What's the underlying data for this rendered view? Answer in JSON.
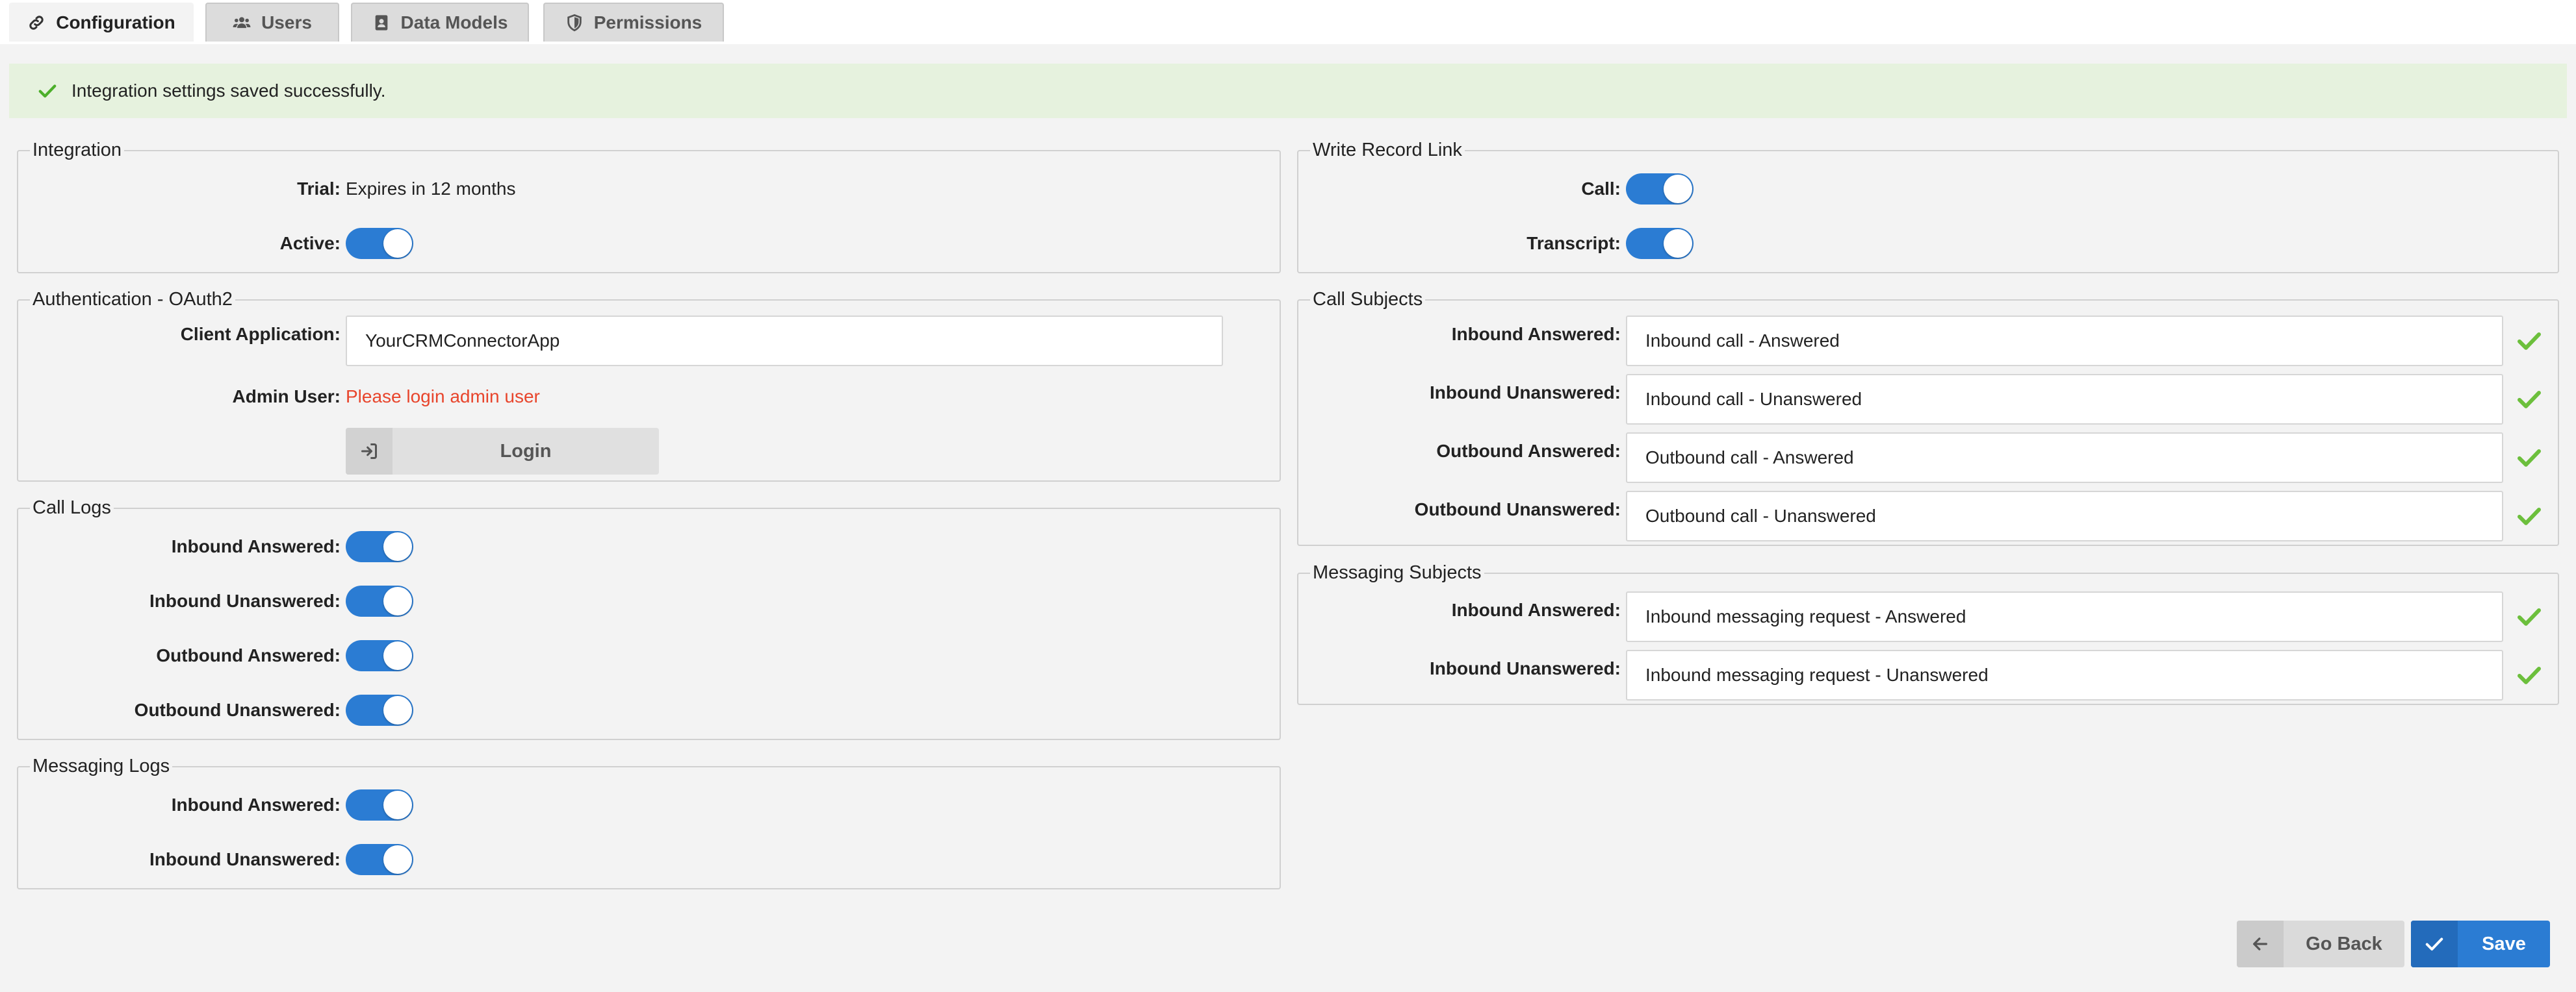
{
  "tabs": [
    {
      "label": "Configuration",
      "icon": "link-icon",
      "active": true
    },
    {
      "label": "Users",
      "icon": "users-icon",
      "active": false
    },
    {
      "label": "Data Models",
      "icon": "address-book-icon",
      "active": false
    },
    {
      "label": "Permissions",
      "icon": "shield-icon",
      "active": false
    }
  ],
  "banner": {
    "message": "Integration settings saved successfully.",
    "icon": "check-icon"
  },
  "integration": {
    "title": "Integration",
    "trial_label": "Trial:",
    "trial_value": "Expires in 12 months",
    "active_label": "Active:",
    "active_on": true
  },
  "auth": {
    "title": "Authentication - OAuth2",
    "client_label": "Client Application:",
    "client_value": "YourCRMConnectorApp",
    "admin_label": "Admin User:",
    "admin_value": "Please login admin user",
    "login_label": "Login"
  },
  "call_logs": {
    "title": "Call Logs",
    "items": [
      {
        "label": "Inbound Answered:",
        "on": true
      },
      {
        "label": "Inbound Unanswered:",
        "on": true
      },
      {
        "label": "Outbound Answered:",
        "on": true
      },
      {
        "label": "Outbound Unanswered:",
        "on": true
      }
    ]
  },
  "messaging_logs": {
    "title": "Messaging Logs",
    "items": [
      {
        "label": "Inbound Answered:",
        "on": true
      },
      {
        "label": "Inbound Unanswered:",
        "on": true
      }
    ]
  },
  "write_record_link": {
    "title": "Write Record Link",
    "items": [
      {
        "label": "Call:",
        "on": true
      },
      {
        "label": "Transcript:",
        "on": true
      }
    ]
  },
  "call_subjects": {
    "title": "Call Subjects",
    "items": [
      {
        "label": "Inbound Answered:",
        "value": "Inbound call - Answered"
      },
      {
        "label": "Inbound Unanswered:",
        "value": "Inbound call - Unanswered"
      },
      {
        "label": "Outbound Answered:",
        "value": "Outbound call - Answered"
      },
      {
        "label": "Outbound Unanswered:",
        "value": "Outbound call - Unanswered"
      }
    ]
  },
  "messaging_subjects": {
    "title": "Messaging Subjects",
    "items": [
      {
        "label": "Inbound Answered:",
        "value": "Inbound messaging request - Answered"
      },
      {
        "label": "Inbound Unanswered:",
        "value": "Inbound messaging request - Unanswered"
      }
    ]
  },
  "footer": {
    "back_label": "Go Back",
    "save_label": "Save"
  },
  "colors": {
    "accent": "#2b7cd3",
    "success": "#6cbf3c",
    "warning_text": "#e8452c",
    "banner_bg": "#e6f2de"
  }
}
